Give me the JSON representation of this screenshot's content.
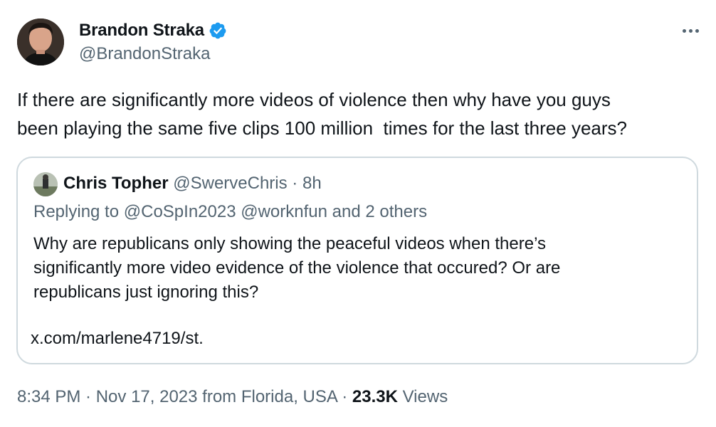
{
  "author": {
    "display_name": "Brandon Straka",
    "handle": "@BrandonStraka",
    "avatar_icon": "profile-photo",
    "verified_color": "#1d9bf0"
  },
  "more_icon": "more-horizontal-icon",
  "tweet": {
    "text": "If there are significantly more videos of violence then why have you guys\nbeen playing the same five clips 100 million  times for the last three years?"
  },
  "quote": {
    "author_name": "Chris Topher",
    "author_handle": "@SwerveChris",
    "separator": " · ",
    "time": "8h",
    "replying_prefix": "Replying to ",
    "mention_1": "@CoSpIn2023",
    "mention_2": "@worknfun",
    "replying_suffix": " and 2 others",
    "text": "Why are republicans only showing the peaceful videos when there’s\nsignificantly more video evidence of the violence that occured? Or are\nrepublicans just ignoring this?",
    "link": "x.com/marlene4719/st."
  },
  "footer": {
    "time": "8:34 PM",
    "sep1": " · ",
    "date": "Nov 17, 2023",
    "location": " from Florida, USA",
    "sep2": " · ",
    "views_count": "23.3K",
    "views_label": " Views"
  }
}
